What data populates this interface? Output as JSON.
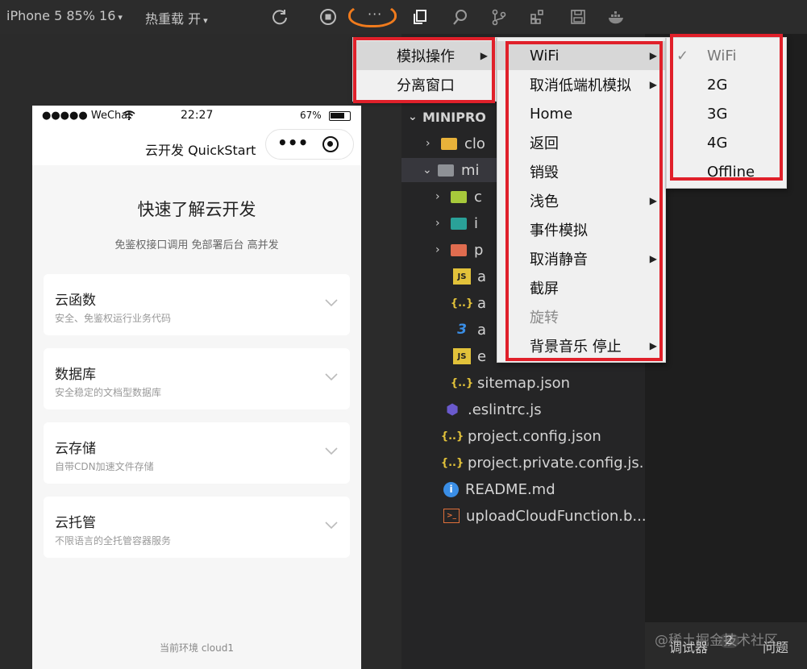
{
  "toolbar": {
    "device": "iPhone 5 85% 16",
    "hot_reload": "热重载 开",
    "caret": "▾",
    "more": "···"
  },
  "simulator": {
    "status": {
      "carrier": "●●●●● WeChat",
      "time": "22:27",
      "battery": "67%"
    },
    "nav_title": "云开发 QuickStart",
    "capsule_dots": "•••",
    "title": "快速了解云开发",
    "subtitle": "免鉴权接口调用 免部署后台 高并发",
    "cards": [
      {
        "title": "云函数",
        "desc": "安全、免鉴权运行业务代码"
      },
      {
        "title": "数据库",
        "desc": "安全稳定的文档型数据库"
      },
      {
        "title": "云存储",
        "desc": "自带CDN加速文件存储"
      },
      {
        "title": "云托管",
        "desc": "不限语言的全托管容器服务"
      }
    ],
    "env": "当前环境 cloud1"
  },
  "explorer": {
    "root": "MINIPRO",
    "items": [
      {
        "label": "clo",
        "icon": "folder-icon",
        "color": "#e8b23a"
      },
      {
        "label": "mi",
        "icon": "folder-open-icon",
        "color": "#8e9196"
      },
      {
        "label": "c",
        "icon": "folder-icon",
        "color": "#a7c93b"
      },
      {
        "label": "i",
        "icon": "folder-icon",
        "color": "#2aa198"
      },
      {
        "label": "p",
        "icon": "folder-icon",
        "color": "#e06c4f"
      },
      {
        "label": "a",
        "icon": "js-icon",
        "glyph": "JS"
      },
      {
        "label": "a",
        "icon": "json-icon",
        "glyph": "{..}"
      },
      {
        "label": "a",
        "icon": "css-icon",
        "glyph": "3"
      },
      {
        "label": "e",
        "icon": "js-icon",
        "glyph": "JS"
      },
      {
        "label": "sitemap.json",
        "icon": "json-icon",
        "glyph": "{..}"
      },
      {
        "label": ".eslintrc.js",
        "icon": "eslint-icon",
        "glyph": "⬢"
      },
      {
        "label": "project.config.json",
        "icon": "json-icon",
        "glyph": "{..}"
      },
      {
        "label": "project.private.config.js...",
        "icon": "json-icon",
        "glyph": "{..}"
      },
      {
        "label": "README.md",
        "icon": "info-icon",
        "glyph": "i"
      },
      {
        "label": "uploadCloudFunction.b...",
        "icon": "terminal-icon",
        "glyph": ">_"
      }
    ]
  },
  "menus": {
    "main": [
      {
        "label": "模拟操作",
        "has_sub": true,
        "highlighted": true
      },
      {
        "label": "分离窗口",
        "has_sub": false
      }
    ],
    "simulate": [
      {
        "label": "WiFi",
        "has_sub": true,
        "highlighted": true
      },
      {
        "label": "取消低端机模拟",
        "has_sub": true
      },
      {
        "label": "Home"
      },
      {
        "label": "返回"
      },
      {
        "label": "销毁"
      },
      {
        "label": "浅色",
        "has_sub": true
      },
      {
        "label": "事件模拟"
      },
      {
        "label": "取消静音",
        "has_sub": true
      },
      {
        "label": "截屏"
      },
      {
        "label": "旋转",
        "disabled": true
      },
      {
        "label": "背景音乐 停止",
        "has_sub": true
      }
    ],
    "network": [
      {
        "label": "WiFi",
        "checked": true
      },
      {
        "label": "2G"
      },
      {
        "label": "3G"
      },
      {
        "label": "4G"
      },
      {
        "label": "Offline"
      }
    ],
    "submenu_arrow": "▶",
    "check": "✓"
  },
  "bottom": {
    "debugger": "调试器",
    "count": "2",
    "issues": "问题"
  },
  "watermark": "@稀土掘金技术社区",
  "colors": {
    "annotation_red": "#e0202a",
    "annotation_orange": "#f07b1d"
  }
}
